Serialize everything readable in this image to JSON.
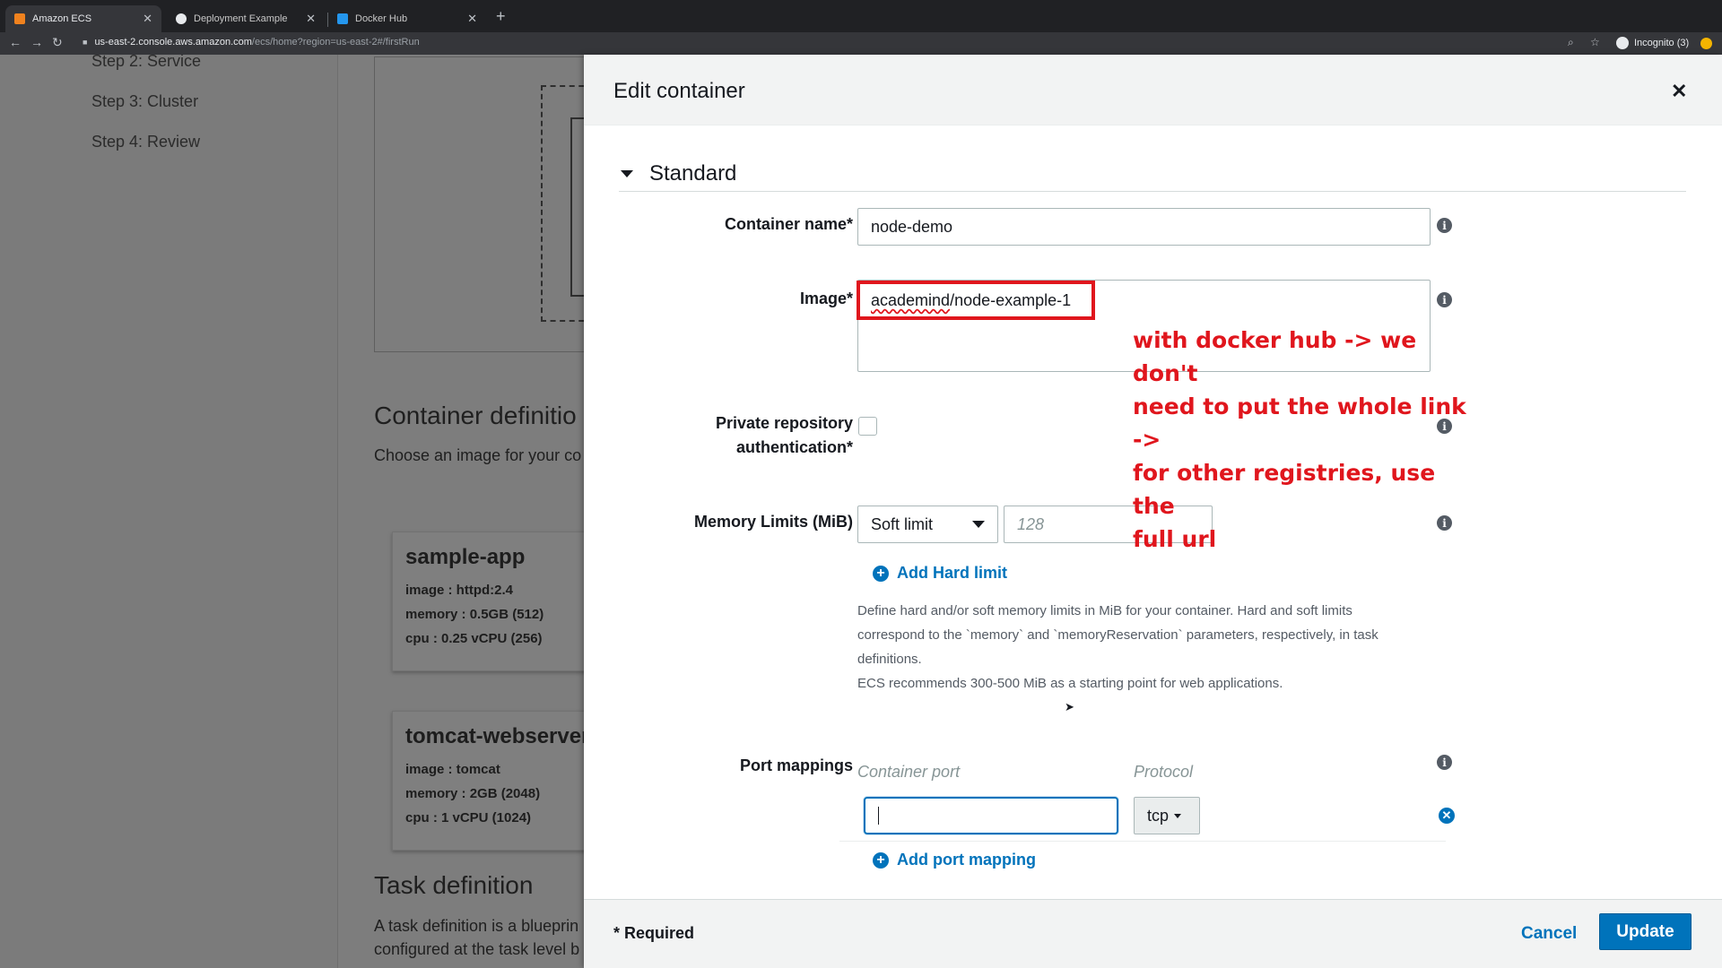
{
  "browser": {
    "tabs": [
      {
        "title": "Amazon ECS",
        "active": true,
        "favicon_color": "#f0821e"
      },
      {
        "title": "Deployment Example",
        "active": false,
        "favicon_color": "#e8eaed"
      },
      {
        "title": "Docker Hub",
        "active": false,
        "favicon_color": "#2496ed"
      }
    ],
    "url_host": "us-east-2.console.aws.amazon.com",
    "url_path": "/ecs/home?region=us-east-2#/firstRun",
    "incognito_label": "Incognito (3)"
  },
  "background": {
    "steps": [
      "Step 2: Service",
      "Step 3: Cluster",
      "Step 4: Review"
    ],
    "container_def_heading": "Container definitio",
    "container_def_desc": "Choose an image for your co",
    "cards": [
      {
        "name": "sample-app",
        "image": "image : httpd:2.4",
        "memory": "memory :  0.5GB (512)",
        "cpu": "cpu :  0.25 vCPU (256)"
      },
      {
        "name": "tomcat-webserver",
        "image": "image : tomcat",
        "memory": "memory :  2GB (2048)",
        "cpu": "cpu :  1 vCPU (1024)"
      }
    ],
    "task_def_heading": "Task definition",
    "task_def_desc_1": "A task definition is a blueprin",
    "task_def_desc_2": "configured at the task level b"
  },
  "modal": {
    "title": "Edit container",
    "section": "Standard",
    "fields": {
      "container_name": {
        "label": "Container name*",
        "value": "node-demo"
      },
      "image": {
        "label": "Image*",
        "value_prefix": "academind",
        "value_suffix": "/node-example-1"
      },
      "private_repo": {
        "label_1": "Private repository",
        "label_2": "authentication*",
        "checked": false
      },
      "memory": {
        "label": "Memory Limits (MiB)",
        "select_value": "Soft limit",
        "placeholder": "128"
      },
      "add_hard_limit": "Add Hard limit",
      "memory_help_1": "Define hard and/or soft memory limits in MiB for your container. Hard and soft limits",
      "memory_help_2": "correspond to the `memory` and `memoryReservation` parameters, respectively, in task",
      "memory_help_3": "definitions.",
      "memory_help_4": "ECS recommends 300-500 MiB as a starting point for web applications.",
      "port_mappings": {
        "label": "Port mappings",
        "col_container_port": "Container port",
        "col_protocol": "Protocol",
        "rows": [
          {
            "container_port": "",
            "protocol": "tcp"
          }
        ],
        "add_label": "Add port mapping"
      }
    },
    "footer": {
      "required_note": "* Required",
      "cancel": "Cancel",
      "update": "Update"
    }
  },
  "annotation": {
    "lines": [
      "with docker hub -> we don't",
      "need to put the whole link ->",
      "for other registries, use the",
      "full url"
    ],
    "color": "#e0161d"
  },
  "colors": {
    "aws_link_blue": "#0073bb",
    "text_dark": "#16191f"
  }
}
